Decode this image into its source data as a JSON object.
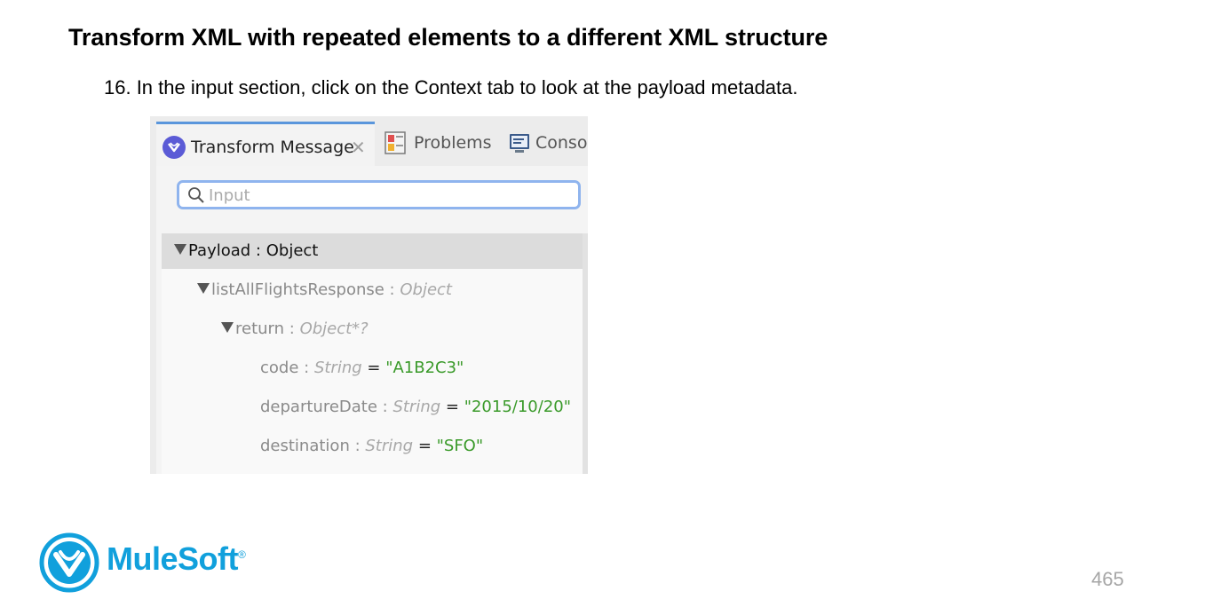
{
  "page": {
    "title": "Transform XML with repeated elements to a different XML structure",
    "step": "16. In the input section, click on the Context tab to look at the payload metadata.",
    "page_number": "465"
  },
  "brand": {
    "name": "MuleSoft",
    "mark": "®",
    "accent": "#11a0dc"
  },
  "panel": {
    "tabs": [
      {
        "label": "Transform Message",
        "icon": "mule-logo-icon",
        "active": true,
        "close": "✕"
      },
      {
        "label": "Problems",
        "icon": "problems-icon"
      },
      {
        "label": "Consol",
        "icon": "console-icon"
      }
    ],
    "search": {
      "placeholder": "Input",
      "icon": "search-icon"
    },
    "tree": [
      {
        "name": "Payload",
        "sep": " : ",
        "type": "Object",
        "expanded": true,
        "selected": true
      },
      {
        "name": "listAllFlightsResponse",
        "sep": " : ",
        "type": "Object",
        "expanded": true
      },
      {
        "name": "return",
        "sep": " : ",
        "type": "Object*?",
        "expanded": true
      },
      {
        "name": "code",
        "sep": " : ",
        "type": "String",
        "eq": " = ",
        "value": "\"A1B2C3\""
      },
      {
        "name": "departureDate",
        "sep": " : ",
        "type": "String",
        "eq": " = ",
        "value": "\"2015/10/20\""
      },
      {
        "name": "destination",
        "sep": " : ",
        "type": "String",
        "eq": " = ",
        "value": "\"SFO\""
      }
    ]
  }
}
